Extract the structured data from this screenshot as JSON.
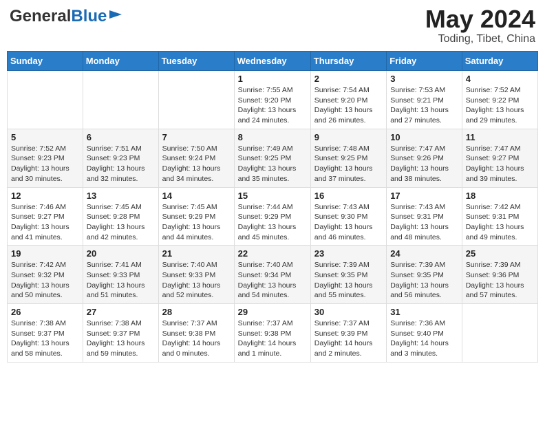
{
  "header": {
    "logo_general": "General",
    "logo_blue": "Blue",
    "month_year": "May 2024",
    "location": "Toding, Tibet, China"
  },
  "weekdays": [
    "Sunday",
    "Monday",
    "Tuesday",
    "Wednesday",
    "Thursday",
    "Friday",
    "Saturday"
  ],
  "weeks": [
    [
      {
        "day": "",
        "info": ""
      },
      {
        "day": "",
        "info": ""
      },
      {
        "day": "",
        "info": ""
      },
      {
        "day": "1",
        "info": "Sunrise: 7:55 AM\nSunset: 9:20 PM\nDaylight: 13 hours\nand 24 minutes."
      },
      {
        "day": "2",
        "info": "Sunrise: 7:54 AM\nSunset: 9:20 PM\nDaylight: 13 hours\nand 26 minutes."
      },
      {
        "day": "3",
        "info": "Sunrise: 7:53 AM\nSunset: 9:21 PM\nDaylight: 13 hours\nand 27 minutes."
      },
      {
        "day": "4",
        "info": "Sunrise: 7:52 AM\nSunset: 9:22 PM\nDaylight: 13 hours\nand 29 minutes."
      }
    ],
    [
      {
        "day": "5",
        "info": "Sunrise: 7:52 AM\nSunset: 9:23 PM\nDaylight: 13 hours\nand 30 minutes."
      },
      {
        "day": "6",
        "info": "Sunrise: 7:51 AM\nSunset: 9:23 PM\nDaylight: 13 hours\nand 32 minutes."
      },
      {
        "day": "7",
        "info": "Sunrise: 7:50 AM\nSunset: 9:24 PM\nDaylight: 13 hours\nand 34 minutes."
      },
      {
        "day": "8",
        "info": "Sunrise: 7:49 AM\nSunset: 9:25 PM\nDaylight: 13 hours\nand 35 minutes."
      },
      {
        "day": "9",
        "info": "Sunrise: 7:48 AM\nSunset: 9:25 PM\nDaylight: 13 hours\nand 37 minutes."
      },
      {
        "day": "10",
        "info": "Sunrise: 7:47 AM\nSunset: 9:26 PM\nDaylight: 13 hours\nand 38 minutes."
      },
      {
        "day": "11",
        "info": "Sunrise: 7:47 AM\nSunset: 9:27 PM\nDaylight: 13 hours\nand 39 minutes."
      }
    ],
    [
      {
        "day": "12",
        "info": "Sunrise: 7:46 AM\nSunset: 9:27 PM\nDaylight: 13 hours\nand 41 minutes."
      },
      {
        "day": "13",
        "info": "Sunrise: 7:45 AM\nSunset: 9:28 PM\nDaylight: 13 hours\nand 42 minutes."
      },
      {
        "day": "14",
        "info": "Sunrise: 7:45 AM\nSunset: 9:29 PM\nDaylight: 13 hours\nand 44 minutes."
      },
      {
        "day": "15",
        "info": "Sunrise: 7:44 AM\nSunset: 9:29 PM\nDaylight: 13 hours\nand 45 minutes."
      },
      {
        "day": "16",
        "info": "Sunrise: 7:43 AM\nSunset: 9:30 PM\nDaylight: 13 hours\nand 46 minutes."
      },
      {
        "day": "17",
        "info": "Sunrise: 7:43 AM\nSunset: 9:31 PM\nDaylight: 13 hours\nand 48 minutes."
      },
      {
        "day": "18",
        "info": "Sunrise: 7:42 AM\nSunset: 9:31 PM\nDaylight: 13 hours\nand 49 minutes."
      }
    ],
    [
      {
        "day": "19",
        "info": "Sunrise: 7:42 AM\nSunset: 9:32 PM\nDaylight: 13 hours\nand 50 minutes."
      },
      {
        "day": "20",
        "info": "Sunrise: 7:41 AM\nSunset: 9:33 PM\nDaylight: 13 hours\nand 51 minutes."
      },
      {
        "day": "21",
        "info": "Sunrise: 7:40 AM\nSunset: 9:33 PM\nDaylight: 13 hours\nand 52 minutes."
      },
      {
        "day": "22",
        "info": "Sunrise: 7:40 AM\nSunset: 9:34 PM\nDaylight: 13 hours\nand 54 minutes."
      },
      {
        "day": "23",
        "info": "Sunrise: 7:39 AM\nSunset: 9:35 PM\nDaylight: 13 hours\nand 55 minutes."
      },
      {
        "day": "24",
        "info": "Sunrise: 7:39 AM\nSunset: 9:35 PM\nDaylight: 13 hours\nand 56 minutes."
      },
      {
        "day": "25",
        "info": "Sunrise: 7:39 AM\nSunset: 9:36 PM\nDaylight: 13 hours\nand 57 minutes."
      }
    ],
    [
      {
        "day": "26",
        "info": "Sunrise: 7:38 AM\nSunset: 9:37 PM\nDaylight: 13 hours\nand 58 minutes."
      },
      {
        "day": "27",
        "info": "Sunrise: 7:38 AM\nSunset: 9:37 PM\nDaylight: 13 hours\nand 59 minutes."
      },
      {
        "day": "28",
        "info": "Sunrise: 7:37 AM\nSunset: 9:38 PM\nDaylight: 14 hours\nand 0 minutes."
      },
      {
        "day": "29",
        "info": "Sunrise: 7:37 AM\nSunset: 9:38 PM\nDaylight: 14 hours\nand 1 minute."
      },
      {
        "day": "30",
        "info": "Sunrise: 7:37 AM\nSunset: 9:39 PM\nDaylight: 14 hours\nand 2 minutes."
      },
      {
        "day": "31",
        "info": "Sunrise: 7:36 AM\nSunset: 9:40 PM\nDaylight: 14 hours\nand 3 minutes."
      },
      {
        "day": "",
        "info": ""
      }
    ]
  ]
}
